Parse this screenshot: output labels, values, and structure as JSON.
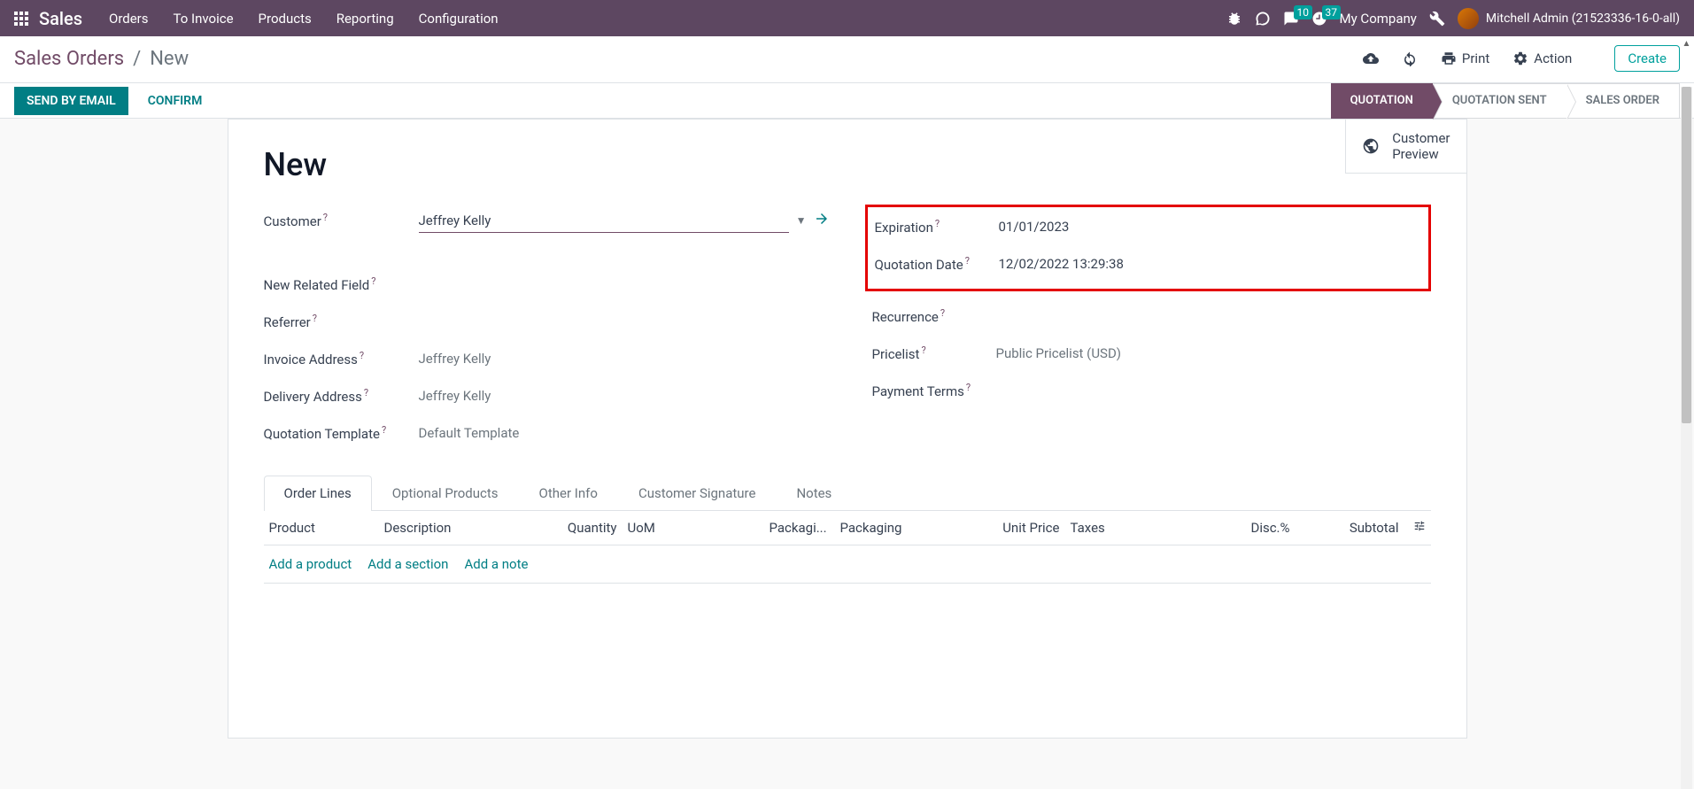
{
  "nav": {
    "brand": "Sales",
    "links": [
      "Orders",
      "To Invoice",
      "Products",
      "Reporting",
      "Configuration"
    ],
    "messages_count": "10",
    "activities_count": "37",
    "company": "My Company",
    "user": "Mitchell Admin (21523336-16-0-all)"
  },
  "control_panel": {
    "breadcrumb_root": "Sales Orders",
    "breadcrumb_current": "New",
    "print": "Print",
    "action": "Action",
    "create": "Create"
  },
  "status_bar": {
    "send_by_email": "SEND BY EMAIL",
    "confirm": "CONFIRM",
    "stages": [
      "QUOTATION",
      "QUOTATION SENT",
      "SALES ORDER"
    ]
  },
  "customer_preview": {
    "line1": "Customer",
    "line2": "Preview"
  },
  "form": {
    "title": "New",
    "customer_label": "Customer",
    "customer_value": "Jeffrey Kelly",
    "new_related_field_label": "New Related Field",
    "referrer_label": "Referrer",
    "invoice_address_label": "Invoice Address",
    "invoice_address_value": "Jeffrey Kelly",
    "delivery_address_label": "Delivery Address",
    "delivery_address_value": "Jeffrey Kelly",
    "quotation_template_label": "Quotation Template",
    "quotation_template_value": "Default Template",
    "expiration_label": "Expiration",
    "expiration_value": "01/01/2023",
    "quotation_date_label": "Quotation Date",
    "quotation_date_value": "12/02/2022 13:29:38",
    "recurrence_label": "Recurrence",
    "pricelist_label": "Pricelist",
    "pricelist_value": "Public Pricelist (USD)",
    "payment_terms_label": "Payment Terms"
  },
  "tabs": [
    "Order Lines",
    "Optional Products",
    "Other Info",
    "Customer Signature",
    "Notes"
  ],
  "table": {
    "headers": {
      "product": "Product",
      "description": "Description",
      "quantity": "Quantity",
      "uom": "UoM",
      "packagi": "Packagi...",
      "packaging": "Packaging",
      "unit_price": "Unit Price",
      "taxes": "Taxes",
      "disc": "Disc.%",
      "subtotal": "Subtotal"
    },
    "add_product": "Add a product",
    "add_section": "Add a section",
    "add_note": "Add a note"
  }
}
